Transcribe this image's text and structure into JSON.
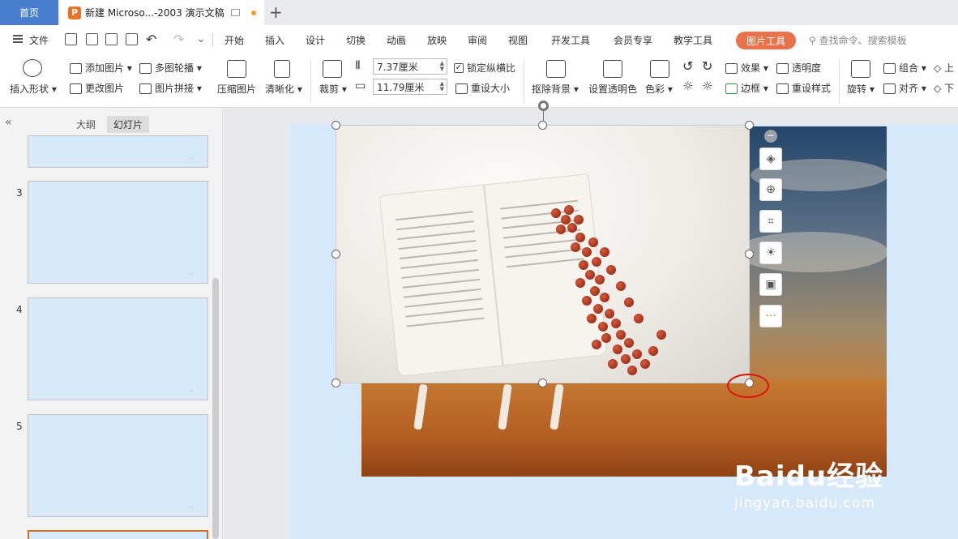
{
  "tabs": {
    "home": "首页",
    "doc_title": "新建 Microso...-2003 演示文稿",
    "logo_letter": "P"
  },
  "menu": {
    "file": "文件",
    "items": [
      "开始",
      "插入",
      "设计",
      "切换",
      "动画",
      "放映",
      "审阅",
      "视图",
      "开发工具",
      "会员专享",
      "教学工具"
    ],
    "picture_tools": "图片工具",
    "search_placeholder": "查找命令、搜索模板"
  },
  "ribbon": {
    "insert_shape": "插入形状",
    "add_picture": "添加图片",
    "change_picture": "更改图片",
    "multi_carousel": "多图轮播",
    "picture_stitch": "图片拼接",
    "compress": "压缩图片",
    "sharpen": "清晰化",
    "crop": "裁剪",
    "width": "7.37厘米",
    "height": "11.79厘米",
    "lock_ratio": "锁定纵横比",
    "reset_size": "重设大小",
    "remove_bg": "抠除背景",
    "set_transparent": "设置透明色",
    "color": "色彩",
    "effects": "效果",
    "transparency": "透明度",
    "border": "边框",
    "reset_style": "重设样式",
    "rotate": "旋转",
    "group": "组合",
    "align": "对齐",
    "up": "上",
    "down": "下"
  },
  "panel": {
    "outline_tab": "大纲",
    "slides_tab": "幻灯片",
    "slide_numbers": [
      "3",
      "4",
      "5"
    ]
  },
  "floatbar_icons": [
    "layers-icon",
    "zoom-icon",
    "crop-icon",
    "idea-icon",
    "image-text-icon",
    "more-icon"
  ],
  "watermark": {
    "main": "Baidu经验",
    "sub": "jingyan.baidu.com"
  },
  "colors": {
    "accent": "#e8734a",
    "home_tab": "#4a7fd0",
    "slide_bg": "#d6e9fb",
    "annotation": "#e01010"
  }
}
